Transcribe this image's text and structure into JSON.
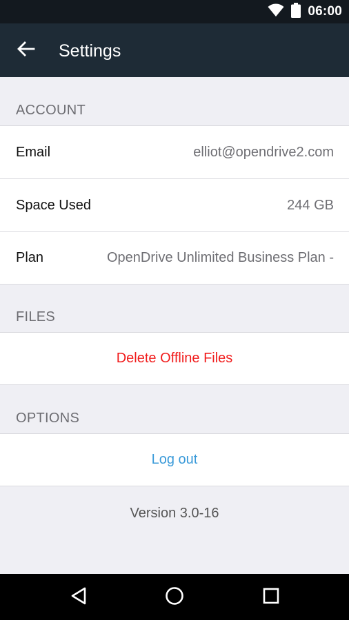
{
  "status_bar": {
    "time": "06:00",
    "icons": [
      "wifi-icon",
      "battery-icon"
    ]
  },
  "app_bar": {
    "title": "Settings",
    "back_icon": "arrow-back-icon"
  },
  "sections": {
    "account": {
      "header": "ACCOUNT",
      "email": {
        "label": "Email",
        "value": "elliot@opendrive2.com"
      },
      "space_used": {
        "label": "Space Used",
        "value": "244 GB"
      },
      "plan": {
        "label": "Plan",
        "value": "OpenDrive Unlimited Business Plan -"
      }
    },
    "files": {
      "header": "FILES",
      "delete_offline": "Delete Offline Files"
    },
    "options": {
      "header": "OPTIONS",
      "logout": "Log out"
    }
  },
  "version": "Version 3.0-16",
  "colors": {
    "status_bar": "#13191f",
    "app_bar": "#1e2b36",
    "background": "#efeff4",
    "destructive": "#f11b1b",
    "link": "#3a9ad9"
  },
  "nav_bar": {
    "icons": [
      "back-triangle-icon",
      "home-circle-icon",
      "recents-square-icon"
    ]
  }
}
